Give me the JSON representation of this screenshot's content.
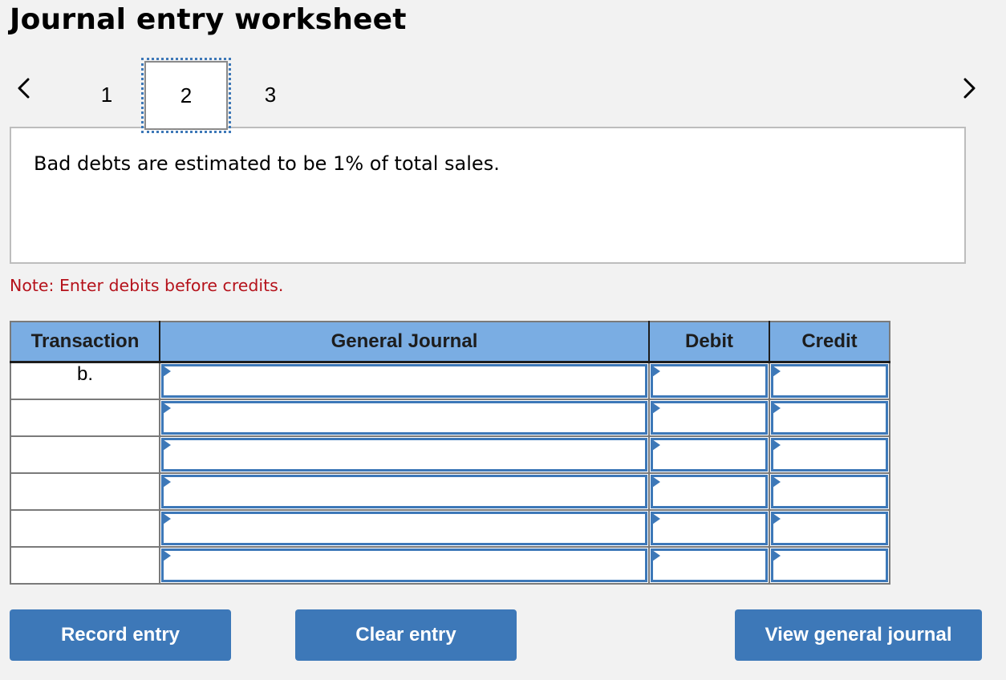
{
  "page": {
    "title": "Journal entry worksheet"
  },
  "navigation": {
    "prev_icon": "chevron-left-icon",
    "next_icon": "chevron-right-icon",
    "tabs": [
      {
        "label": "1",
        "active": false
      },
      {
        "label": "2",
        "active": true
      },
      {
        "label": "3",
        "active": false
      }
    ]
  },
  "question": {
    "text": "Bad debts are estimated to be 1% of total sales."
  },
  "note": {
    "text": "Note: Enter debits before credits.",
    "color": "#b5121b"
  },
  "journal_table": {
    "headers": {
      "transaction": "Transaction",
      "general_journal": "General Journal",
      "debit": "Debit",
      "credit": "Credit"
    },
    "header_color": "#7aade3",
    "rows": [
      {
        "transaction": "b.",
        "account": "",
        "debit": "",
        "credit": ""
      },
      {
        "transaction": "",
        "account": "",
        "debit": "",
        "credit": ""
      },
      {
        "transaction": "",
        "account": "",
        "debit": "",
        "credit": ""
      },
      {
        "transaction": "",
        "account": "",
        "debit": "",
        "credit": ""
      },
      {
        "transaction": "",
        "account": "",
        "debit": "",
        "credit": ""
      },
      {
        "transaction": "",
        "account": "",
        "debit": "",
        "credit": ""
      }
    ]
  },
  "buttons": {
    "record_entry": "Record entry",
    "clear_entry": "Clear entry",
    "view_general_journal": "View general journal",
    "color": "#3d78b8"
  }
}
